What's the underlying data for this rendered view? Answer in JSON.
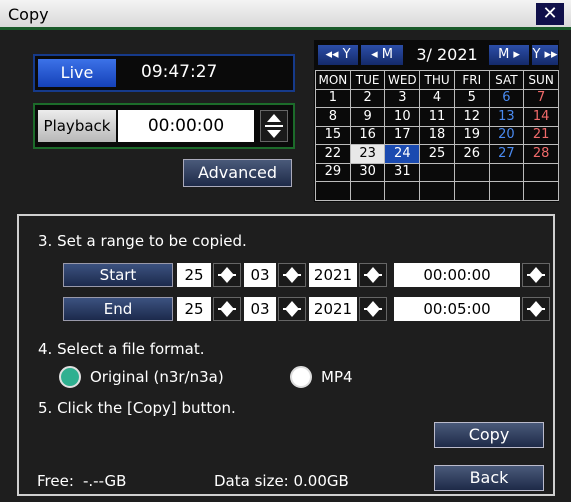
{
  "window": {
    "title": "Copy",
    "close_glyph": "✕"
  },
  "live": {
    "label": "Live",
    "time": "09:47:27"
  },
  "playback": {
    "label": "Playback",
    "time": "00:00:00"
  },
  "advanced_label": "Advanced",
  "calendar": {
    "nav_prev_year": "◂◂ Y",
    "nav_prev_month": "◂ M",
    "month_year": "3/ 2021",
    "nav_next_month": "M ▸",
    "nav_next_year": "Y ▸▸",
    "weekdays": [
      "MON",
      "TUE",
      "WED",
      "THU",
      "FRI",
      "SAT",
      "SUN"
    ],
    "weeks": [
      [
        "1",
        "2",
        "3",
        "4",
        "5",
        "6",
        "7"
      ],
      [
        "8",
        "9",
        "10",
        "11",
        "12",
        "13",
        "14"
      ],
      [
        "15",
        "16",
        "17",
        "18",
        "19",
        "20",
        "21"
      ],
      [
        "22",
        "23",
        "24",
        "25",
        "26",
        "27",
        "28"
      ],
      [
        "29",
        "30",
        "31",
        "",
        "",
        "",
        ""
      ],
      [
        "",
        "",
        "",
        "",
        "",
        "",
        ""
      ]
    ],
    "today": "23",
    "selected": "24"
  },
  "range": {
    "heading": "3. Set a range to be copied.",
    "start": {
      "label": "Start",
      "day": "25",
      "month": "03",
      "year": "2021",
      "time": "00:00:00"
    },
    "end": {
      "label": "End",
      "day": "25",
      "month": "03",
      "year": "2021",
      "time": "00:05:00"
    }
  },
  "format": {
    "heading": "4. Select a file format.",
    "option_original": "Original (n3r/n3a)",
    "option_mp4": "MP4",
    "selected": "Original (n3r/n3a)"
  },
  "copy_step": "5. Click the [Copy] button.",
  "buttons": {
    "copy": "Copy",
    "back": "Back"
  },
  "footer": {
    "free_label": "Free:",
    "free_value": "-.--GB",
    "data_size": "Data size: 0.00GB"
  },
  "colors": {
    "title_border": "#1a5a2a",
    "live_blue": "#1541b8",
    "playback_green": "#1c6b2a",
    "calendar_selected": "#1a4ab0",
    "sat_color": "#4a8af0",
    "sun_color": "#f06a6a",
    "radio_selected": "#2fb090"
  },
  "icons": {
    "close": "close-icon",
    "spinner": "spinner-up-down-icon"
  }
}
